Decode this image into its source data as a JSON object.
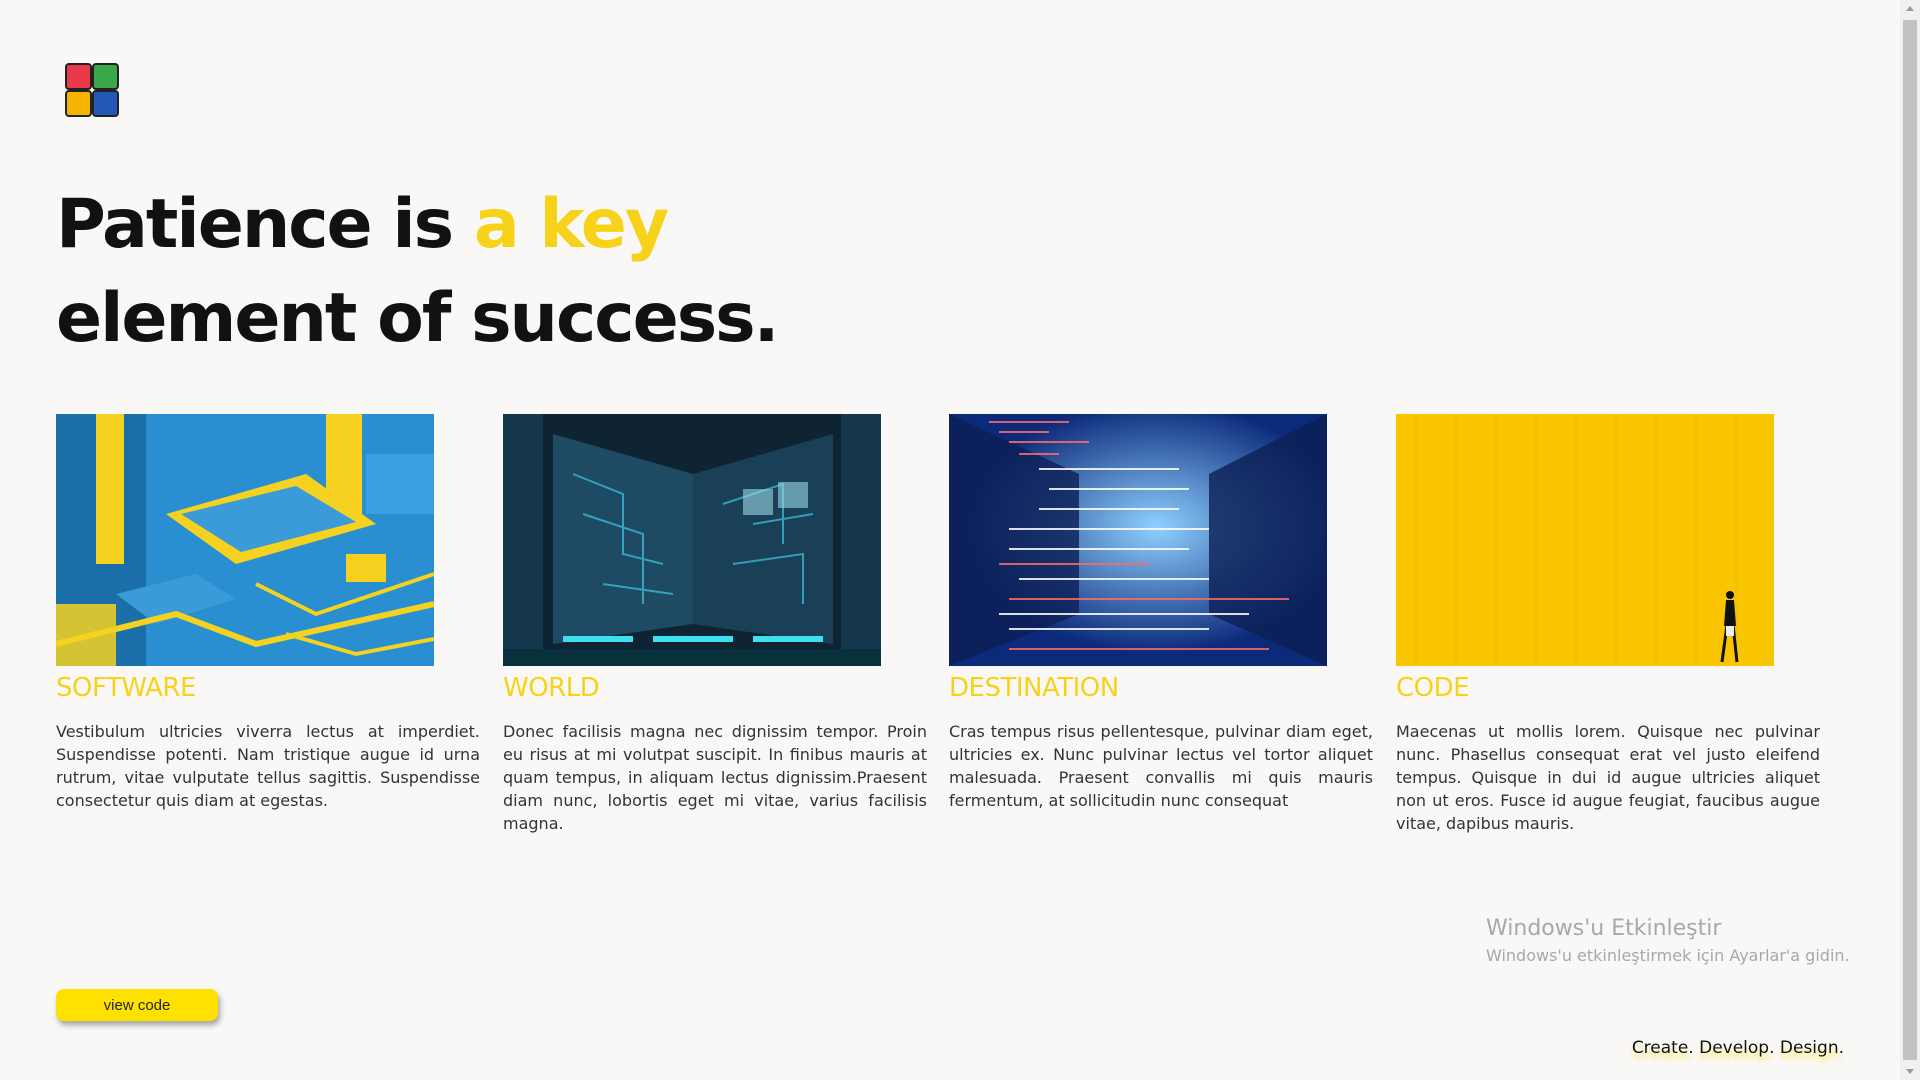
{
  "logo": {
    "icon": "colored-grid-logo-icon",
    "colors": [
      "#ea3a4a",
      "#3aa84a",
      "#f5b400",
      "#2458b8"
    ]
  },
  "headline": {
    "line1_plain": "Patience is ",
    "line1_accent": "a key",
    "line2": "element of success."
  },
  "colors": {
    "accent": "#f7d21a",
    "button": "#ffe100"
  },
  "cards": [
    {
      "title": "SOFTWARE",
      "image": "yellow-blue-circuit-board-image",
      "text": "Vestibulum ultricies viverra lectus at imperdiet. Suspendisse potenti. Nam tristique augue id urna rutrum, vitae vulputate tellus sagittis. Suspendisse consectetur quis diam at egestas."
    },
    {
      "title": "WORLD",
      "image": "dark-server-room-circuit-image",
      "text": "Donec facilisis magna nec dignissim tempor. Proin eu risus at mi volutpat suscipit. In finibus mauris at quam tempus, in aliquam lectus dignissim.Praesent diam nunc, lobortis eget mi vitae, varius facilisis magna."
    },
    {
      "title": "DESTINATION",
      "image": "code-over-datacenter-image",
      "text": "Cras tempus risus pellentesque, pulvinar diam eget, ultricies ex. Nunc pulvinar lectus vel tortor aliquet malesuada. Praesent convallis mi quis mauris fermentum, at sollicitudin nunc consequat"
    },
    {
      "title": "CODE",
      "image": "yellow-wall-walking-person-image",
      "text": "Maecenas ut mollis lorem. Quisque nec pulvinar nunc. Phasellus consequat erat vel justo eleifend tempus. Quisque in dui id augue ultricies aliquet non ut eros. Fusce id augue feugiat, faucibus augue vitae, dapibus mauris."
    }
  ],
  "button": {
    "label": "view code"
  },
  "watermark": {
    "title": "Windows'u Etkinleştir",
    "subtitle": "Windows'u etkinleştirmek için Ayarlar'a gidin."
  },
  "tagline": "Create. Develop. Design."
}
